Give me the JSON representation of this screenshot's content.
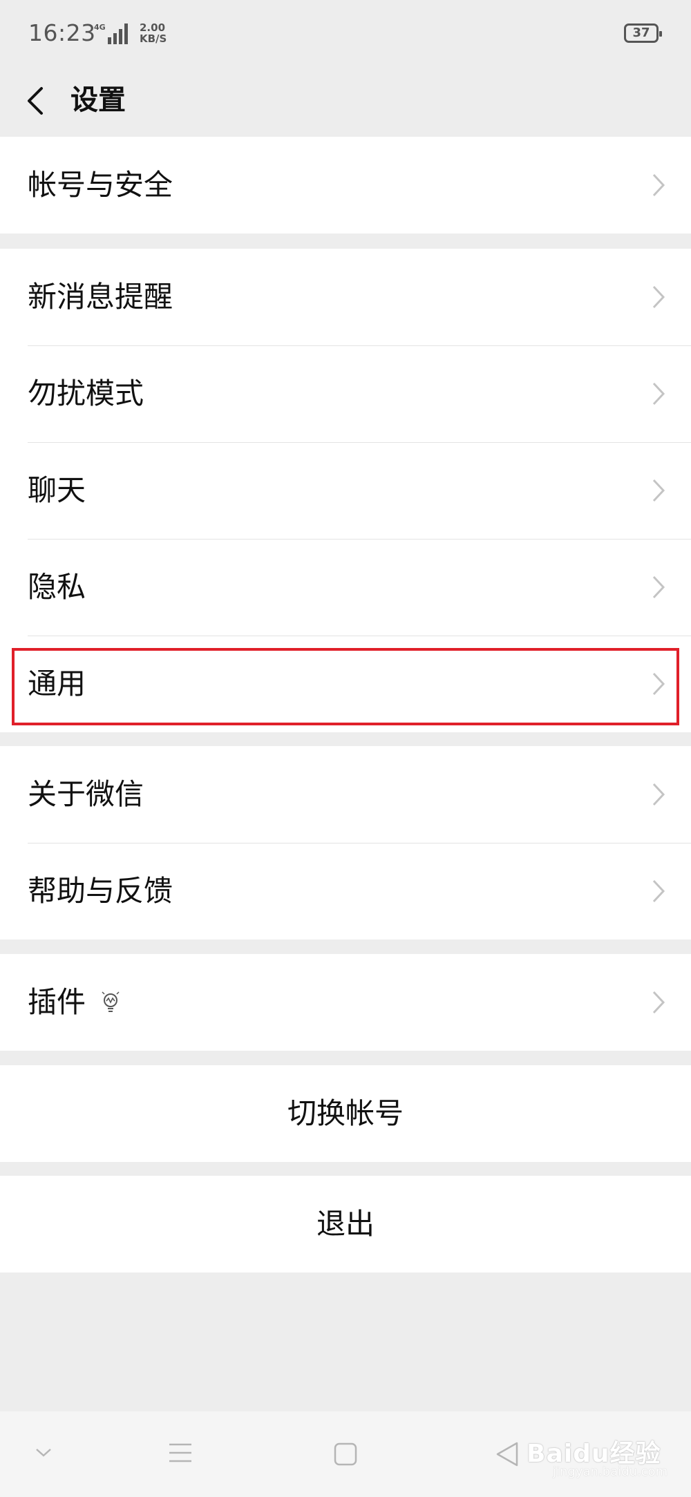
{
  "status_bar": {
    "time": "16:23",
    "network": "4G",
    "speed_value": "2.00",
    "speed_unit": "KB/S",
    "battery": "37"
  },
  "header": {
    "title": "设置"
  },
  "groups": {
    "account": [
      {
        "label": "帐号与安全"
      }
    ],
    "main": [
      {
        "label": "新消息提醒"
      },
      {
        "label": "勿扰模式"
      },
      {
        "label": "聊天"
      },
      {
        "label": "隐私"
      },
      {
        "label": "通用"
      }
    ],
    "about": [
      {
        "label": "关于微信"
      },
      {
        "label": "帮助与反馈"
      }
    ],
    "plugins": [
      {
        "label": "插件"
      }
    ]
  },
  "actions": {
    "switch_account": "切换帐号",
    "logout": "退出"
  },
  "highlight_color": "#e0202a",
  "watermark": {
    "brand": "Baidu经验",
    "site": "jingyan.baidu.com"
  },
  "icons": {
    "back": "chevron-left-icon",
    "row_arrow": "chevron-right-icon",
    "plugin": "lightbulb-icon"
  }
}
